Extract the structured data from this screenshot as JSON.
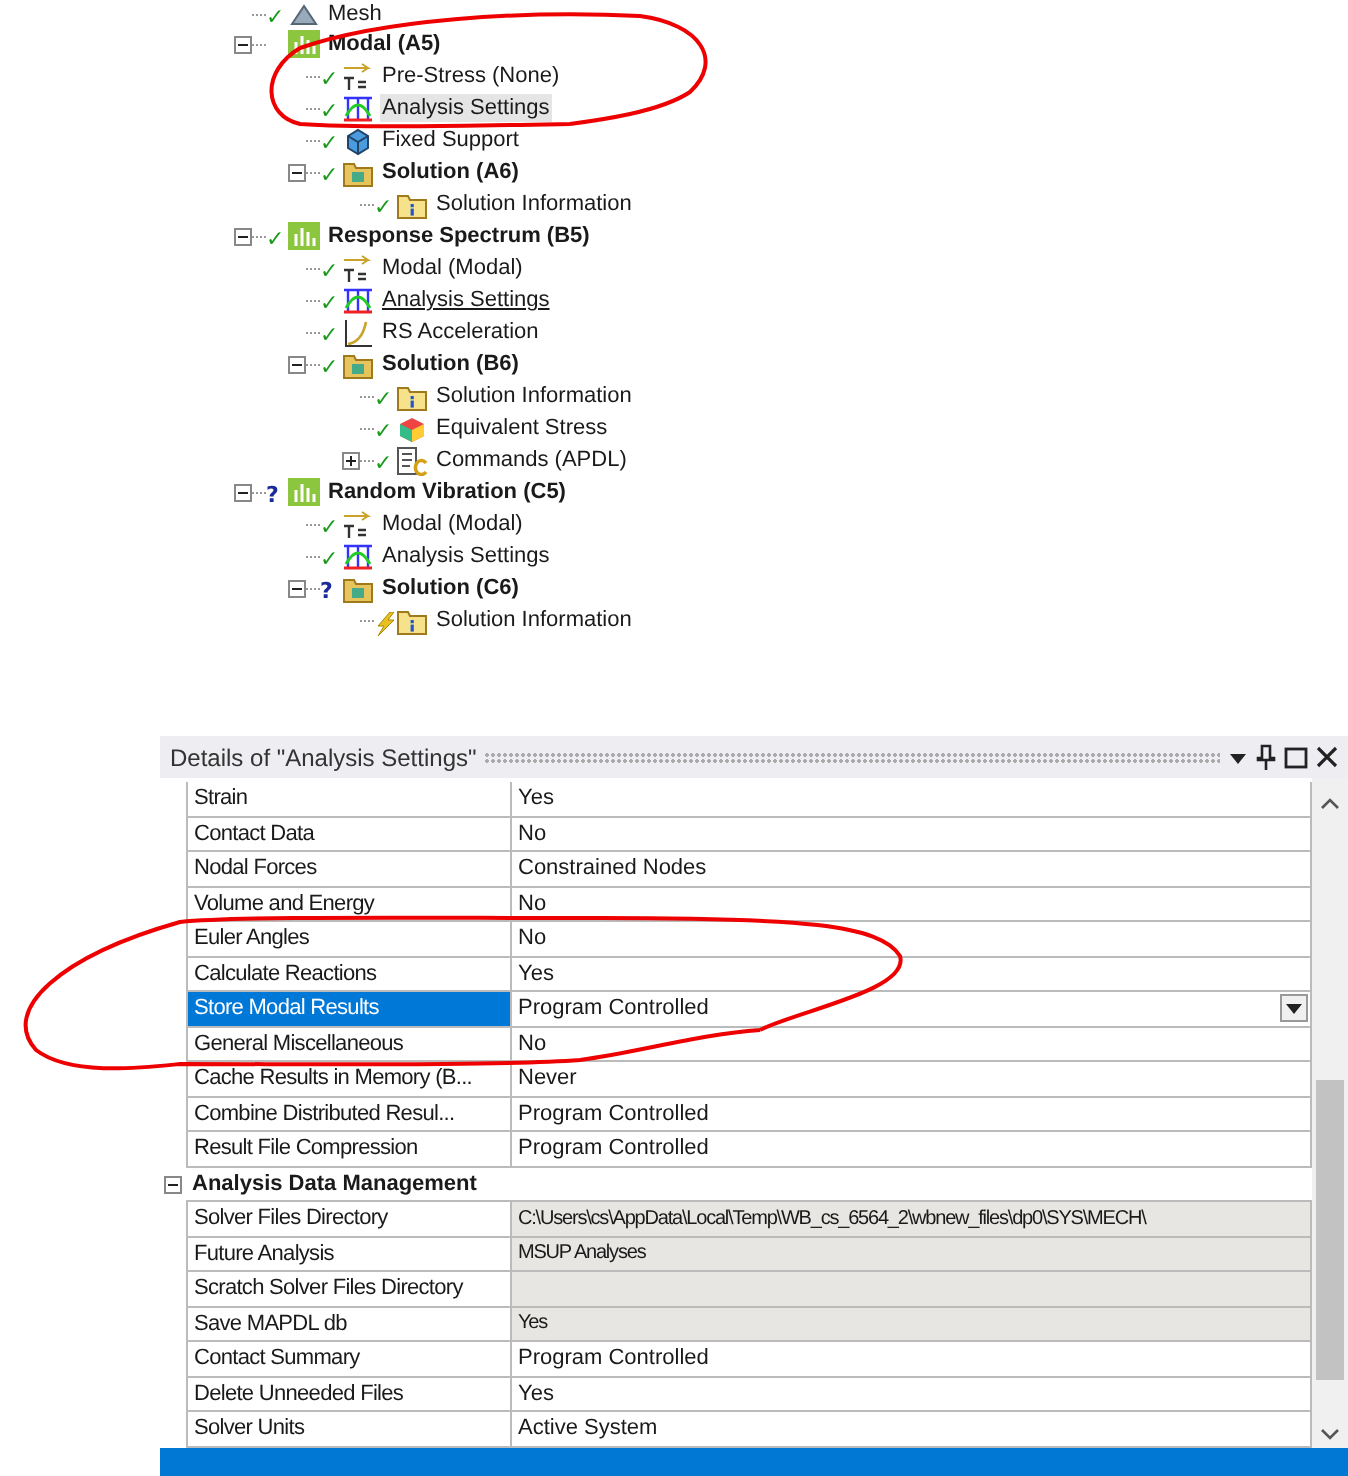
{
  "tree": [
    {
      "label": "Mesh",
      "kind": "mesh",
      "status": "✓"
    },
    {
      "label": "Modal (A5)",
      "kind": "system",
      "expanded": true,
      "children": [
        {
          "label": "Pre-Stress (None)",
          "kind": "prestress",
          "status": "✓",
          "selected": false,
          "hovered": false
        },
        {
          "label": "Analysis Settings",
          "kind": "settings",
          "status": "✓",
          "selected": true,
          "hovered": false
        },
        {
          "label": "Fixed Support",
          "kind": "support",
          "status": "✓",
          "selected": false,
          "hovered": false
        },
        {
          "label": "Solution (A6)",
          "kind": "solution",
          "status": "✓",
          "expanded": true,
          "children": [
            {
              "label": "Solution Information",
              "kind": "info",
              "status": "✓",
              "selected": false,
              "hovered": false
            }
          ]
        }
      ]
    },
    {
      "label": "Response Spectrum (B5)",
      "kind": "system",
      "status": "✓",
      "expanded": true,
      "children": [
        {
          "label": "Modal (Modal)",
          "kind": "prestress",
          "status": "✓",
          "selected": false,
          "hovered": false
        },
        {
          "label": "Analysis Settings",
          "kind": "settings",
          "status": "✓",
          "selected": false,
          "hovered": true
        },
        {
          "label": "RS Acceleration",
          "kind": "accel",
          "status": "✓",
          "selected": false,
          "hovered": false
        },
        {
          "label": "Solution (B6)",
          "kind": "solution",
          "status": "✓",
          "expanded": true,
          "children": [
            {
              "label": "Solution Information",
              "kind": "info",
              "status": "✓",
              "selected": false,
              "hovered": false
            },
            {
              "label": "Equivalent Stress",
              "kind": "stress",
              "status": "✓",
              "selected": false,
              "hovered": false
            },
            {
              "label": "Commands (APDL)",
              "kind": "commands",
              "status": "✓",
              "expanded": false,
              "selected": false,
              "hovered": false
            }
          ]
        }
      ]
    },
    {
      "label": "Random Vibration (C5)",
      "kind": "system",
      "status": "?",
      "expanded": true,
      "children": [
        {
          "label": "Modal (Modal)",
          "kind": "prestress",
          "status": "✓",
          "selected": false,
          "hovered": false
        },
        {
          "label": "Analysis Settings",
          "kind": "settings",
          "status": "✓",
          "selected": false,
          "hovered": false
        },
        {
          "label": "Solution (C6)",
          "kind": "solution",
          "status": "?",
          "expanded": true,
          "children": [
            {
              "label": "Solution Information",
              "kind": "info",
              "running": true,
              "selected": false,
              "hovered": false
            }
          ]
        }
      ]
    }
  ],
  "details": {
    "title": "Details of \"Analysis Settings\"",
    "rows": [
      {
        "kind": "property",
        "name": "Strain",
        "value": "Yes",
        "selected": false,
        "readonly": false
      },
      {
        "kind": "property",
        "name": "Contact Data",
        "value": "No",
        "selected": false,
        "readonly": false
      },
      {
        "kind": "property",
        "name": "Nodal Forces",
        "value": "Constrained Nodes",
        "selected": false,
        "readonly": false
      },
      {
        "kind": "property",
        "name": "Volume and Energy",
        "value": "No",
        "selected": false,
        "readonly": false
      },
      {
        "kind": "property",
        "name": "Euler Angles",
        "value": "No",
        "selected": false,
        "readonly": false
      },
      {
        "kind": "property",
        "name": "Calculate Reactions",
        "value": "Yes",
        "selected": false,
        "readonly": false
      },
      {
        "kind": "property",
        "name": "Store Modal Results",
        "value": "Program Controlled",
        "selected": true,
        "readonly": false
      },
      {
        "kind": "property",
        "name": "General Miscellaneous",
        "value": "No",
        "selected": false,
        "readonly": false
      },
      {
        "kind": "property",
        "name": "Cache Results in Memory (B...",
        "value": "Never",
        "selected": false,
        "readonly": false
      },
      {
        "kind": "property",
        "name": "Combine Distributed Resul...",
        "value": "Program Controlled",
        "selected": false,
        "readonly": false
      },
      {
        "kind": "property",
        "name": "Result File Compression",
        "value": "Program Controlled",
        "selected": false,
        "readonly": false
      },
      {
        "kind": "section",
        "name": "Analysis Data Management",
        "expanded": true
      },
      {
        "kind": "property",
        "name": "Solver Files Directory",
        "value": "C:\\Users\\cs\\AppData\\Local\\Temp\\WB_cs_6564_2\\wbnew_files\\dp0\\SYS\\MECH\\",
        "selected": false,
        "readonly": true
      },
      {
        "kind": "property",
        "name": "Future Analysis",
        "value": "MSUP Analyses",
        "selected": false,
        "readonly": true
      },
      {
        "kind": "property",
        "name": "Scratch Solver Files Directory",
        "selected": false,
        "readonly": true
      },
      {
        "kind": "property",
        "name": "Save MAPDL db",
        "value": "Yes",
        "selected": false,
        "readonly": true
      },
      {
        "kind": "property",
        "name": "Contact Summary",
        "value": "Program Controlled",
        "selected": false,
        "readonly": false
      },
      {
        "kind": "property",
        "name": "Delete Unneeded Files",
        "value": "Yes",
        "selected": false,
        "readonly": false
      },
      {
        "kind": "property",
        "name": "Solver Units",
        "value": "Active System",
        "selected": false,
        "readonly": false
      }
    ]
  }
}
